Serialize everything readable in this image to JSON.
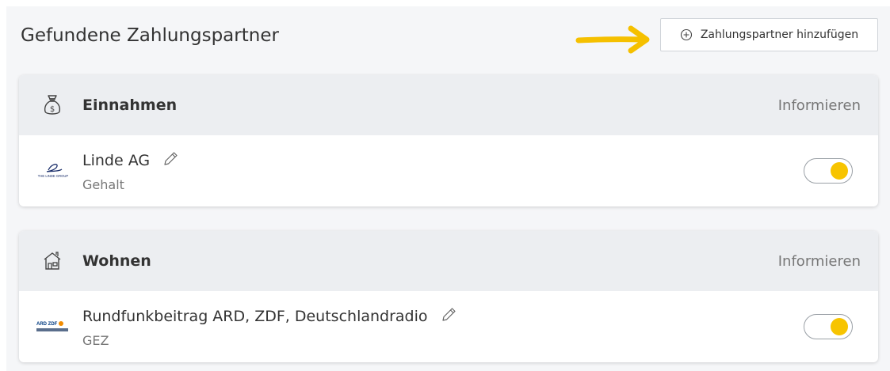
{
  "header": {
    "title": "Gefundene Zahlungspartner",
    "add_button_label": "Zahlungspartner hinzufügen"
  },
  "colors": {
    "accent": "#f7c400",
    "arrow": "#f5c000",
    "card_header": "#eceef1",
    "page_bg": "#f5f6f8"
  },
  "categories": [
    {
      "title": "Einnahmen",
      "icon": "money-bag-icon",
      "inform_label": "Informieren",
      "partners": [
        {
          "name": "Linde AG",
          "subtitle": "Gehalt",
          "logo": "linde-group-logo",
          "logo_text": "THE LINDE GROUP",
          "active": true
        }
      ]
    },
    {
      "title": "Wohnen",
      "icon": "house-icon",
      "inform_label": "Informieren",
      "partners": [
        {
          "name": "Rundfunkbeitrag ARD, ZDF, Deutschlandradio",
          "subtitle": "GEZ",
          "logo": "ard-zdf-logo",
          "logo_text": "ARD ZDF",
          "active": true
        }
      ]
    }
  ]
}
